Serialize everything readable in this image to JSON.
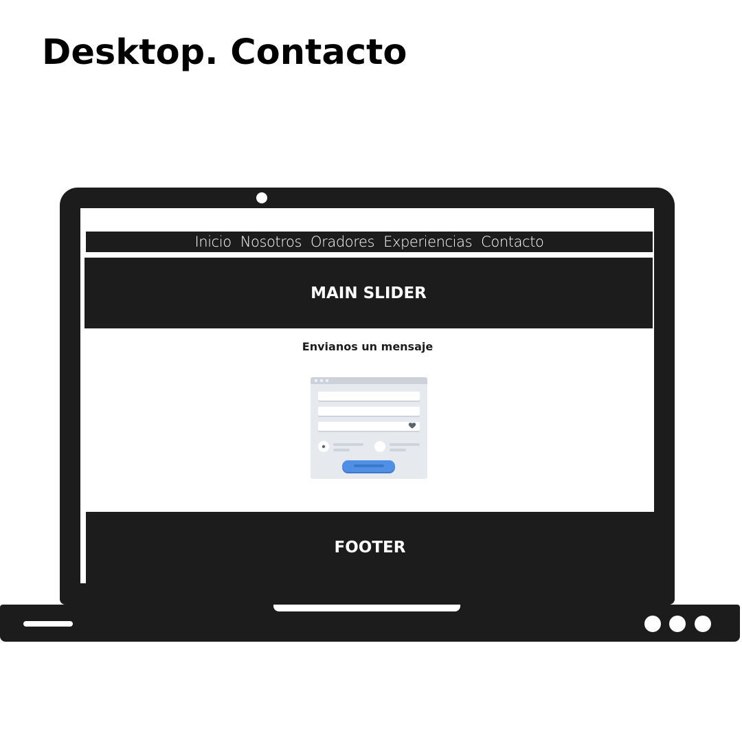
{
  "title": "Desktop. Contacto",
  "nav": {
    "items": [
      {
        "label": "Inicio"
      },
      {
        "label": "Nosotros"
      },
      {
        "label": "Oradores"
      },
      {
        "label": "Experiencias"
      },
      {
        "label": "Contacto"
      }
    ]
  },
  "slider": {
    "label": "MAIN SLIDER"
  },
  "contact": {
    "heading": "Envianos un mensaje"
  },
  "footer": {
    "label": "FOOTER"
  },
  "colors": {
    "frame": "#1c1c1c",
    "screen": "#ffffff",
    "form_bg": "#e6e9ee",
    "form_button": "#4f8fe6"
  },
  "icons": [
    "heart-icon",
    "webcam-icon"
  ]
}
